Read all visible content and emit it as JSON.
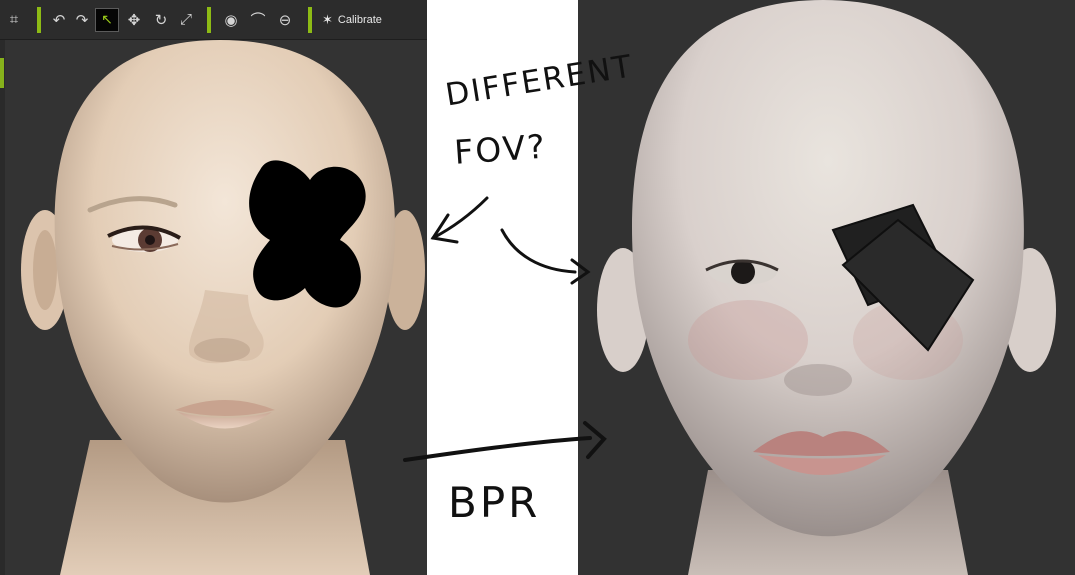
{
  "toolbar": {
    "items": [
      {
        "name": "camera-icon",
        "glyph": "⌗"
      },
      {
        "name": "undo-icon",
        "glyph": "↶"
      },
      {
        "name": "redo-icon",
        "glyph": "↷"
      },
      {
        "name": "select-arrow-icon",
        "glyph": "↖"
      },
      {
        "name": "move-icon",
        "glyph": "✥"
      },
      {
        "name": "rotate-icon",
        "glyph": "↻"
      },
      {
        "name": "scale-icon",
        "glyph": "⤢"
      },
      {
        "name": "eye-icon",
        "glyph": "◉"
      },
      {
        "name": "lower-lid-icon",
        "glyph": "⌒"
      },
      {
        "name": "mouth-icon",
        "glyph": "⊖"
      }
    ],
    "calibrate_label": "Calibrate",
    "calibrate_icon": "✶",
    "accent": "#8dbb15"
  },
  "annotations": {
    "top_line1": "DIFFERENT",
    "top_line2": "FOV?",
    "bottom": "BPR"
  }
}
